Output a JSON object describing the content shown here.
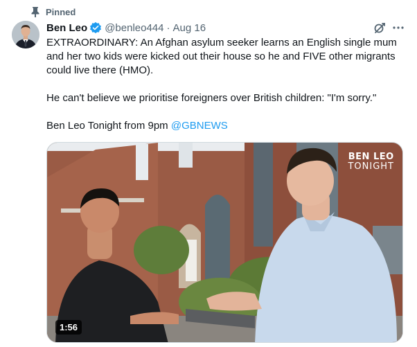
{
  "pinned": {
    "label": "Pinned"
  },
  "author": {
    "display_name": "Ben Leo",
    "handle": "@benleo444",
    "separator": "·",
    "date": "Aug 16"
  },
  "tweet": {
    "line1": "EXTRAORDINARY: An Afghan asylum seeker learns an English single mum and her two kids were kicked out their house so he and FIVE other migrants could live there (HMO).",
    "line2": "He can't believe we prioritise foreigners over British children: \"I'm sorry.\"",
    "line3_prefix": "Ben Leo Tonight from 9pm ",
    "line3_mention": "@GBNEWS"
  },
  "media": {
    "watermark_line1": "BEN LEO",
    "watermark_line2": "TONIGHT",
    "duration": "1:56"
  },
  "colors": {
    "accent": "#1d9bf0",
    "secondary_text": "#536471",
    "primary_text": "#0f1419"
  },
  "icons": [
    "pin-icon",
    "verified-icon",
    "grok-icon",
    "more-icon"
  ]
}
